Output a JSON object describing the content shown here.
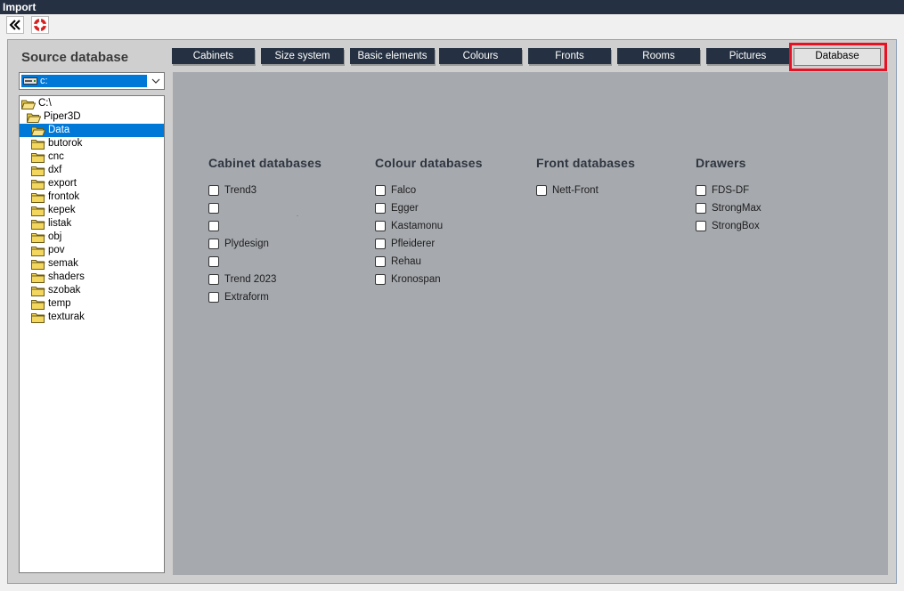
{
  "window": {
    "title": "Import"
  },
  "toolbar": {
    "back_icon": "double-chevron-left-icon",
    "help_icon": "lifebuoy-icon"
  },
  "source": {
    "title": "Source database",
    "drive": "c:",
    "tree": [
      {
        "label": "C:\\",
        "level": 0,
        "open": true
      },
      {
        "label": "Piper3D",
        "level": 1,
        "open": true
      },
      {
        "label": "Data",
        "level": 2,
        "open": true,
        "selected": true
      },
      {
        "label": "butorok",
        "level": 2
      },
      {
        "label": "cnc",
        "level": 2
      },
      {
        "label": "dxf",
        "level": 2
      },
      {
        "label": "export",
        "level": 2
      },
      {
        "label": "frontok",
        "level": 2
      },
      {
        "label": "kepek",
        "level": 2
      },
      {
        "label": "listak",
        "level": 2
      },
      {
        "label": "obj",
        "level": 2
      },
      {
        "label": "pov",
        "level": 2
      },
      {
        "label": "semak",
        "level": 2
      },
      {
        "label": "shaders",
        "level": 2
      },
      {
        "label": "szobak",
        "level": 2
      },
      {
        "label": "temp",
        "level": 2
      },
      {
        "label": "texturak",
        "level": 2
      }
    ]
  },
  "tabs": [
    "Cabinets",
    "Size system",
    "Basic elements",
    "Colours",
    "Fronts",
    "Rooms",
    "Pictures",
    "Database"
  ],
  "active_tab": "Database",
  "groups": [
    {
      "title": "Cabinet databases",
      "items": [
        "Trend3",
        "",
        "",
        "Plydesign",
        "",
        "Trend 2023",
        "Extraform"
      ]
    },
    {
      "title": "Colour databases",
      "items": [
        "Falco",
        "Egger",
        "Kastamonu",
        "Pfleiderer",
        "Rehau",
        "Kronospan"
      ]
    },
    {
      "title": "Front databases",
      "items": [
        "Nett-Front"
      ]
    },
    {
      "title": "Drawers",
      "items": [
        "FDS-DF",
        "StrongMax",
        "StrongBox"
      ]
    }
  ],
  "colors": {
    "titlebar": "#253142",
    "tab": "#253142",
    "panel": "#a6a9ae",
    "highlight": "#e81123",
    "selection": "#0078d7"
  }
}
